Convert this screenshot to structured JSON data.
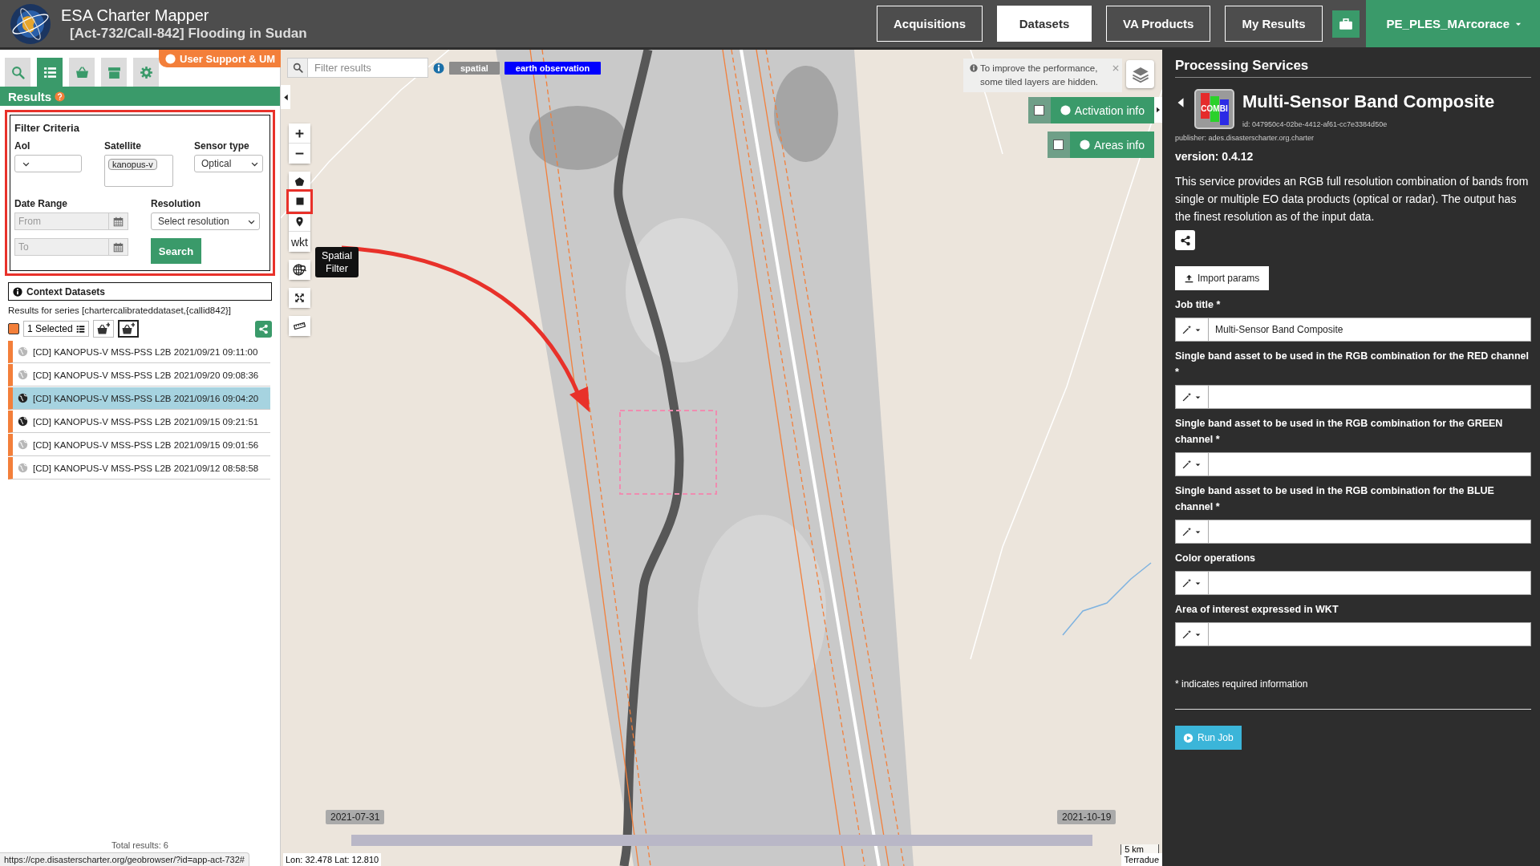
{
  "header": {
    "app_title": "ESA Charter Mapper",
    "subtitle": "[Act-732/Call-842] Flooding in Sudan",
    "nav": [
      {
        "label": "Acquisitions",
        "selected": false
      },
      {
        "label": "Datasets",
        "selected": true
      },
      {
        "label": "VA Products",
        "selected": false
      },
      {
        "label": "My Results",
        "selected": false
      }
    ],
    "user": "PE_PLES_MArcorace"
  },
  "left_panel": {
    "tabs": [
      {
        "kind": "search",
        "selected": false
      },
      {
        "kind": "list",
        "selected": true
      },
      {
        "kind": "basket",
        "selected": false
      },
      {
        "kind": "archive",
        "selected": false
      },
      {
        "kind": "gear",
        "selected": false
      }
    ],
    "support_button": "User Support & UM",
    "results_title": "Results",
    "filter": {
      "title": "Filter Criteria",
      "aoi_label": "AoI",
      "satellite_label": "Satellite",
      "satellite_chip": "kanopus-v",
      "sensor_label": "Sensor type",
      "sensor_value": "Optical",
      "date_label": "Date Range",
      "from_placeholder": "From",
      "to_placeholder": "To",
      "resolution_label": "Resolution",
      "resolution_value": "Select resolution",
      "search_button": "Search"
    },
    "context_title": "Context Datasets",
    "select_all_checked": true,
    "series_text": "Results for series [chartercalibrateddataset,{callid842}]",
    "selection_button": "1 Selected",
    "results": [
      {
        "title": "[CD] KANOPUS-V MSS-PSS L2B 2021/09/21 09:11:00",
        "selected": false,
        "on_map": false
      },
      {
        "title": "[CD] KANOPUS-V MSS-PSS L2B 2021/09/20 09:08:36",
        "selected": false,
        "on_map": false
      },
      {
        "title": "[CD] KANOPUS-V MSS-PSS L2B 2021/09/16 09:04:20",
        "selected": true,
        "on_map": true
      },
      {
        "title": "[CD] KANOPUS-V MSS-PSS L2B 2021/09/15 09:21:51",
        "selected": false,
        "on_map": true
      },
      {
        "title": "[CD] KANOPUS-V MSS-PSS L2B 2021/09/15 09:01:56",
        "selected": false,
        "on_map": false
      },
      {
        "title": "[CD] KANOPUS-V MSS-PSS L2B 2021/09/12 08:58:58",
        "selected": false,
        "on_map": false
      }
    ],
    "total_results": "Total results: 6"
  },
  "map": {
    "filter_placeholder": "Filter results",
    "tags": [
      {
        "label": "spatial",
        "color": "#8c8c8c"
      },
      {
        "label": "earth observation",
        "color": "#0000ff"
      }
    ],
    "wkt_button": "wkt",
    "tooltip": "Spatial Filter",
    "notice": "To improve the performance, some tiled layers are hidden.",
    "overlays": [
      {
        "label": "Activation info",
        "checked": false
      },
      {
        "label": "Areas info",
        "checked": false
      }
    ],
    "timeline": {
      "start": "2021-07-31",
      "end": "2021-10-19"
    },
    "scale": "5 km",
    "coordinates": "Lon: 32.478 Lat: 12.810",
    "attribution": "Terradue"
  },
  "status_url": "https://cpe.disasterscharter.org/geobrowser/?id=app-act-732#",
  "processing": {
    "heading": "Processing Services",
    "logo_text": "COMBI",
    "title": "Multi-Sensor Band Composite",
    "id": "id: 047950c4-02be-4412-af61-cc7e3384d50e",
    "publisher": "publisher: ades.disasterscharter.org.charter",
    "version": "version: 0.4.12",
    "description": "This service provides an RGB full resolution combination of bands from single or multiple EO data products (optical or radar). The output has the finest resolution as of the input data.",
    "import_button": "Import params",
    "fields": [
      {
        "label": "Job title *",
        "value": "Multi-Sensor Band Composite"
      },
      {
        "label": "Single band asset to be used in the RGB combination for the RED channel *"
      },
      {
        "label": "Single band asset to be used in the RGB combination for the GREEN channel *"
      },
      {
        "label": "Single band asset to be used in the RGB combination for the BLUE channel *"
      },
      {
        "label": "Color operations"
      },
      {
        "label": "Area of interest expressed in WKT"
      }
    ],
    "required_note": "* indicates required information",
    "run_button": "Run Job"
  }
}
